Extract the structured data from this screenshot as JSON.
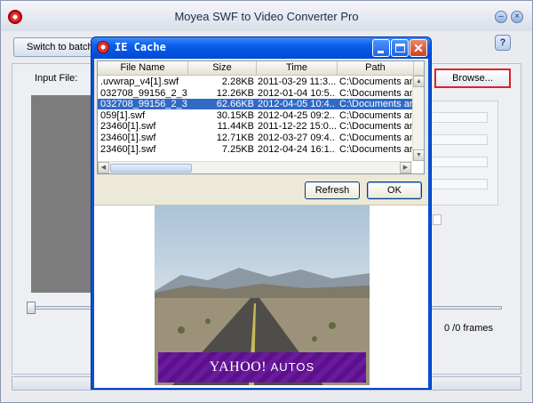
{
  "app": {
    "title": "Moyea SWF to Video Converter Pro",
    "switch_label": "Switch to batch",
    "input_file_label": "Input File:",
    "browse_label": "Browse...",
    "help_glyph": "?",
    "frames_text": "0 /0 frames",
    "minimize_glyph": "–",
    "close_glyph": "×"
  },
  "dialog": {
    "title": "IE Cache",
    "columns": [
      "File Name",
      "Size",
      "Time",
      "Path"
    ],
    "rows": [
      {
        "name": ".uvwrap_v4[1].swf",
        "size": "2.28KB",
        "time": "2011-03-29 11:3...",
        "path": "C:\\Documents and"
      },
      {
        "name": "032708_99156_2_3...",
        "size": "12.26KB",
        "time": "2012-01-04 10:5...",
        "path": "C:\\Documents and"
      },
      {
        "name": "032708_99156_2_3...",
        "size": "62.66KB",
        "time": "2012-04-05 10:4...",
        "path": "C:\\Documents and"
      },
      {
        "name": "059[1].swf",
        "size": "30.15KB",
        "time": "2012-04-25 09:2...",
        "path": "C:\\Documents and"
      },
      {
        "name": "23460[1].swf",
        "size": "11.44KB",
        "time": "2011-12-22 15:0...",
        "path": "C:\\Documents and"
      },
      {
        "name": "23460[1].swf",
        "size": "12.71KB",
        "time": "2012-03-27 09:4...",
        "path": "C:\\Documents and"
      },
      {
        "name": "23460[1].swf",
        "size": "7.25KB",
        "time": "2012-04-24 16:1...",
        "path": "C:\\Documents and"
      }
    ],
    "selected_row": 2,
    "refresh_label": "Refresh",
    "ok_label": "OK"
  },
  "preview": {
    "brand": "YAHOO!",
    "product": "AUTOS"
  }
}
